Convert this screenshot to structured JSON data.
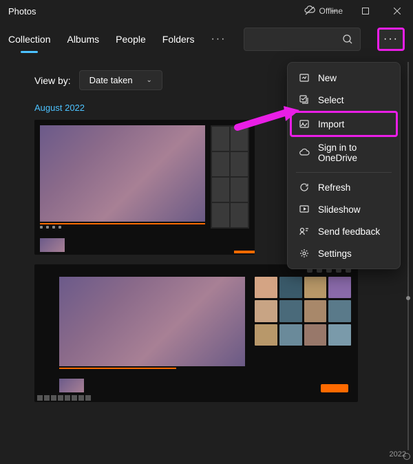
{
  "titlebar": {
    "title": "Photos",
    "offline": "Offline"
  },
  "nav": {
    "tabs": [
      "Collection",
      "Albums",
      "People",
      "Folders"
    ],
    "more": "···"
  },
  "moreBtn": "···",
  "viewby": {
    "label": "View by:",
    "value": "Date taken"
  },
  "dateHeader": "August 2022",
  "menu": {
    "new": "New",
    "select": "Select",
    "import": "Import",
    "signin": "Sign in to OneDrive",
    "refresh": "Refresh",
    "slideshow": "Slideshow",
    "feedback": "Send feedback",
    "settings": "Settings"
  },
  "yearLabel": "2022"
}
